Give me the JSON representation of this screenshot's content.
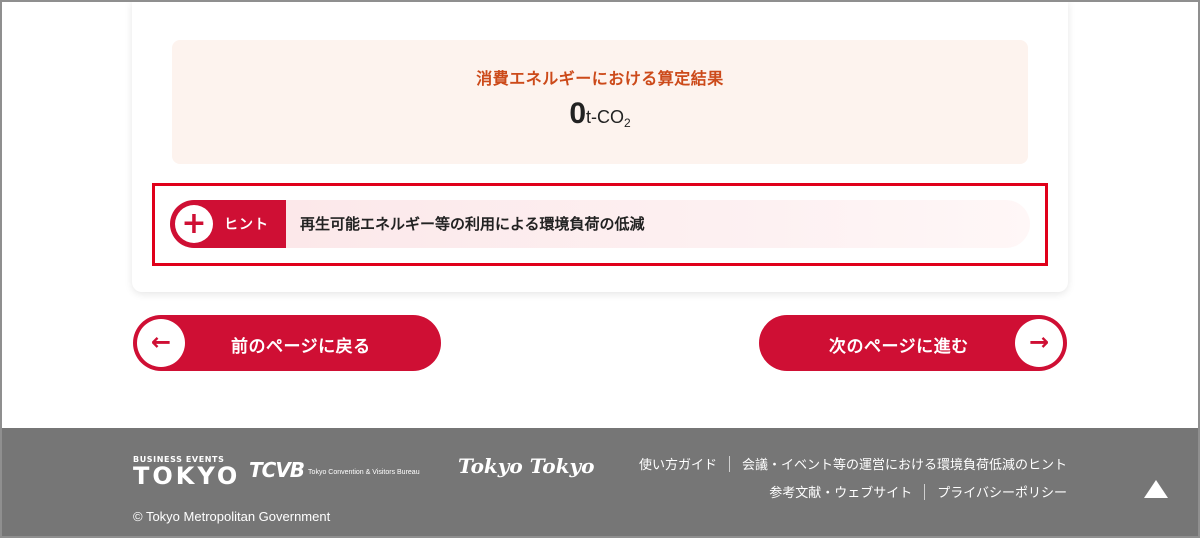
{
  "result": {
    "title": "消費エネルギーにおける算定結果",
    "value": "0",
    "unit": "t-CO",
    "unit_sub": "2"
  },
  "hint": {
    "badge_icon": "plus-icon",
    "badge_symbol": "+",
    "badge_label": "ヒント",
    "text": "再生可能エネルギー等の利用による環境負荷の低減"
  },
  "navigation": {
    "prev": {
      "label": "前のページに戻る",
      "icon": "arrow-left-icon",
      "symbol": "←"
    },
    "next": {
      "label": "次のページに進む",
      "icon": "arrow-right-icon",
      "symbol": "→"
    }
  },
  "footer": {
    "logos": {
      "business_events_small": "BUSINESS EVENTS",
      "business_events_big": "TOKYO",
      "tcvb_mark": "TCVB",
      "tcvb_desc": "Tokyo Convention & Visitors Bureau",
      "tokyo_tokyo": "Tokyo Tokyo"
    },
    "links_row1": [
      "使い方ガイド",
      "会議・イベント等の運営における環境負荷低減のヒント"
    ],
    "links_row2": [
      "参考文献・ウェブサイト",
      "プライバシーポリシー"
    ],
    "copyright": "© Tokyo Metropolitan Government",
    "page_top_icon": "triangle-up-icon"
  },
  "colors": {
    "brand_red": "#cf0f34",
    "result_title": "#cc4a1a",
    "footer_bg": "#767676",
    "highlight_outline": "#e0001a"
  }
}
